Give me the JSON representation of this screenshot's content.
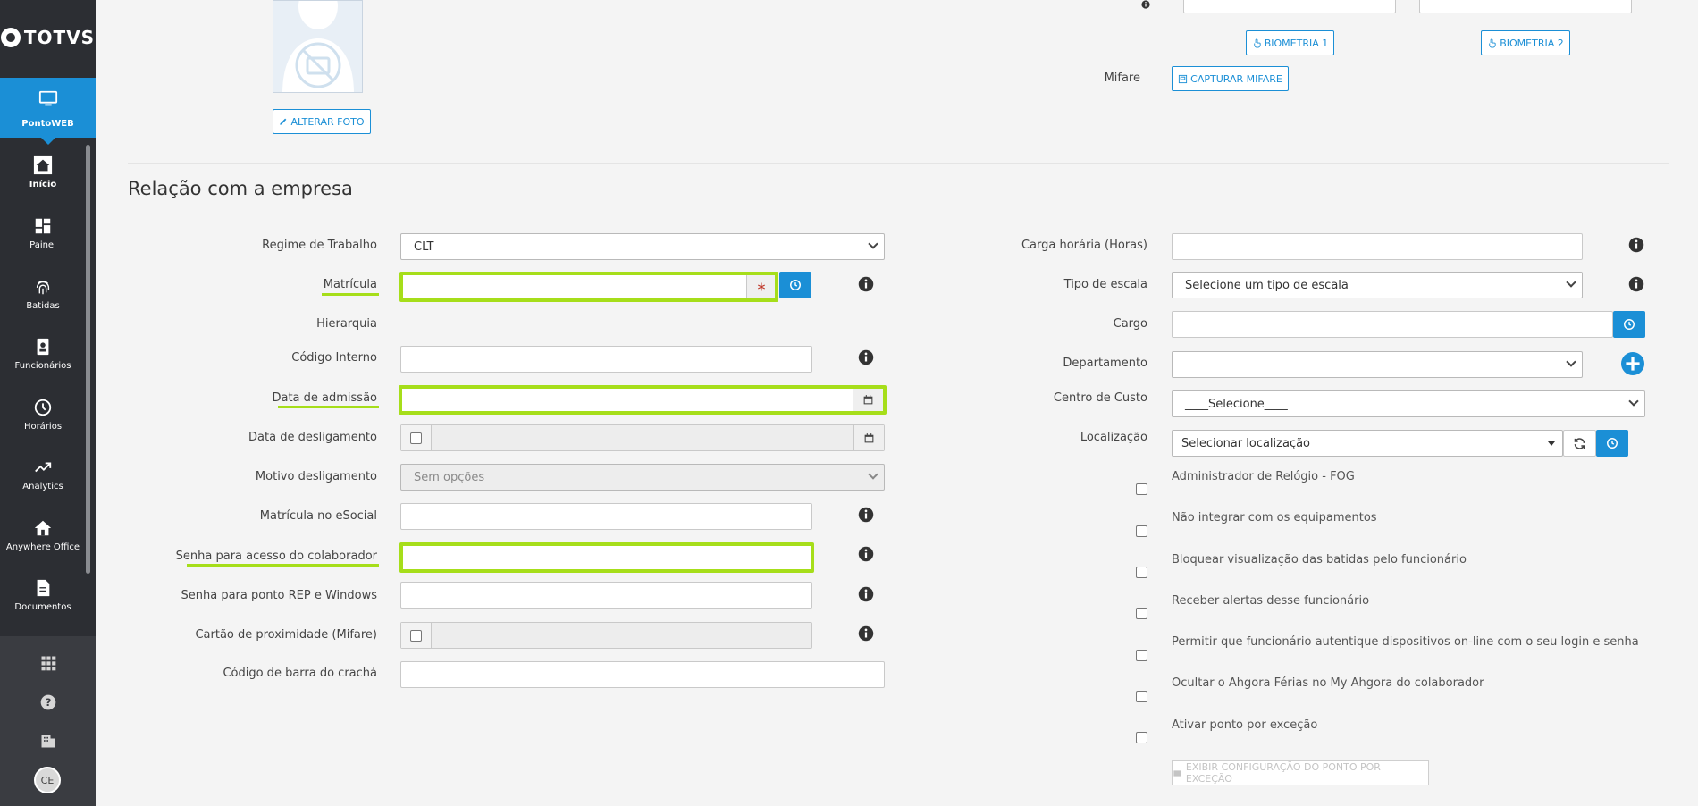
{
  "brand": {
    "name": "TOTVS"
  },
  "product": {
    "label": "PontoWEB",
    "icon": "monitor-icon"
  },
  "nav": [
    {
      "label": "Início",
      "icon": "home-icon",
      "active": true
    },
    {
      "label": "Painel",
      "icon": "dashboard-icon"
    },
    {
      "label": "Batidas",
      "icon": "fingerprint-icon"
    },
    {
      "label": "Funcionários",
      "icon": "badge-icon"
    },
    {
      "label": "Horários",
      "icon": "clock-icon"
    },
    {
      "label": "Analytics",
      "icon": "trending-up-icon"
    },
    {
      "label": "Anywhere Office",
      "icon": "home-office-icon"
    },
    {
      "label": "Documentos",
      "icon": "document-icon"
    }
  ],
  "user": {
    "initials": "CE"
  },
  "photo": {
    "alter_label": "ALTERAR FOTO"
  },
  "biometrics": {
    "bio1_label": "BIOMETRIA 1",
    "bio2_label": "BIOMETRIA 2",
    "mifare_label": "Mifare",
    "capture_label": "CAPTURAR MIFARE"
  },
  "section": {
    "title": "Relação com a empresa"
  },
  "left_form": {
    "regime_label": "Regime de Trabalho",
    "regime_value": "CLT",
    "matricula_label": "Matrícula",
    "hierarquia_label": "Hierarquia",
    "codigo_interno_label": "Código Interno",
    "data_admissao_label": "Data de admissão",
    "data_desligamento_label": "Data de desligamento",
    "motivo_label": "Motivo desligamento",
    "motivo_value": "Sem opções",
    "esocial_label": "Matrícula no eSocial",
    "senha_colab_label": "Senha para acesso do colaborador",
    "senha_rep_label": "Senha para ponto REP e Windows",
    "cartao_label": "Cartão de proximidade (Mifare)",
    "cracha_label": "Código de barra do crachá"
  },
  "right_form": {
    "carga_label": "Carga horária (Horas)",
    "escala_label": "Tipo de escala",
    "escala_value": "Selecione um tipo de escala",
    "cargo_label": "Cargo",
    "departamento_label": "Departamento",
    "centro_label": "Centro de Custo",
    "centro_value": "____Selecione____",
    "localizacao_label": "Localização",
    "localizacao_value": "Selecionar localização"
  },
  "checkboxes": [
    "Administrador de Relógio - FOG",
    "Não integrar com os equipamentos",
    "Bloquear visualização das batidas pelo funcionário",
    "Receber alertas desse funcionário",
    "Permitir que funcionário autentique dispositivos on-line com o seu login e senha",
    "Ocultar o Ahgora Férias no My Ahgora do colaborador",
    "Ativar ponto por exceção"
  ],
  "exception_button": "EXIBIR CONFIGURAÇÃO DO PONTO POR EXCEÇÃO",
  "colors": {
    "accent": "#1b8fd6",
    "highlight": "#a6de1a",
    "sidebar": "#2c2e33"
  }
}
